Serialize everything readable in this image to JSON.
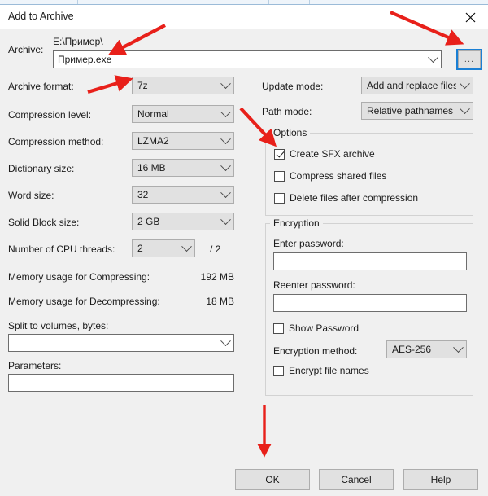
{
  "window": {
    "title": "Add to Archive",
    "close_icon": "close-icon"
  },
  "archive": {
    "label": "Archive:",
    "path_text": "E:\\Пример\\",
    "filename_value": "Пример.exe",
    "browse_label": "...",
    "dropdown_icon": "chevron-down-icon"
  },
  "left_column": [
    {
      "label": "Archive format:",
      "value": "7z"
    },
    {
      "label": "Compression level:",
      "value": "Normal"
    },
    {
      "label": "Compression method:",
      "value": "LZMA2"
    },
    {
      "label": "Dictionary size:",
      "value": "16 MB"
    },
    {
      "label": "Word size:",
      "value": "32"
    },
    {
      "label": "Solid Block size:",
      "value": "2 GB"
    }
  ],
  "cpu_threads": {
    "label": "Number of CPU threads:",
    "value": "2",
    "total": "/ 2"
  },
  "memory": {
    "compressing_label": "Memory usage for Compressing:",
    "compressing_value": "192 MB",
    "decompressing_label": "Memory usage for Decompressing:",
    "decompressing_value": "18 MB"
  },
  "split": {
    "label": "Split to volumes, bytes:",
    "value": ""
  },
  "parameters": {
    "label": "Parameters:",
    "value": ""
  },
  "right_column": [
    {
      "label": "Update mode:",
      "value": "Add and replace files"
    },
    {
      "label": "Path mode:",
      "value": "Relative pathnames"
    }
  ],
  "options": {
    "title": "Options",
    "items": [
      {
        "label": "Create SFX archive",
        "checked": true
      },
      {
        "label": "Compress shared files",
        "checked": false
      },
      {
        "label": "Delete files after compression",
        "checked": false
      }
    ]
  },
  "encryption": {
    "title": "Encryption",
    "enter_password_label": "Enter password:",
    "enter_password_value": "",
    "reenter_password_label": "Reenter password:",
    "reenter_password_value": "",
    "show_password_label": "Show Password",
    "show_password_checked": false,
    "method_label": "Encryption method:",
    "method_value": "AES-256",
    "encrypt_names_label": "Encrypt file names",
    "encrypt_names_checked": false
  },
  "buttons": {
    "ok": "OK",
    "cancel": "Cancel",
    "help": "Help"
  },
  "annotations": {
    "color": "#e8201a",
    "arrows": [
      "arrow-to-archive-filename",
      "arrow-to-browse-button",
      "arrow-to-archive-format",
      "arrow-to-options-group",
      "arrow-to-ok-button"
    ]
  }
}
